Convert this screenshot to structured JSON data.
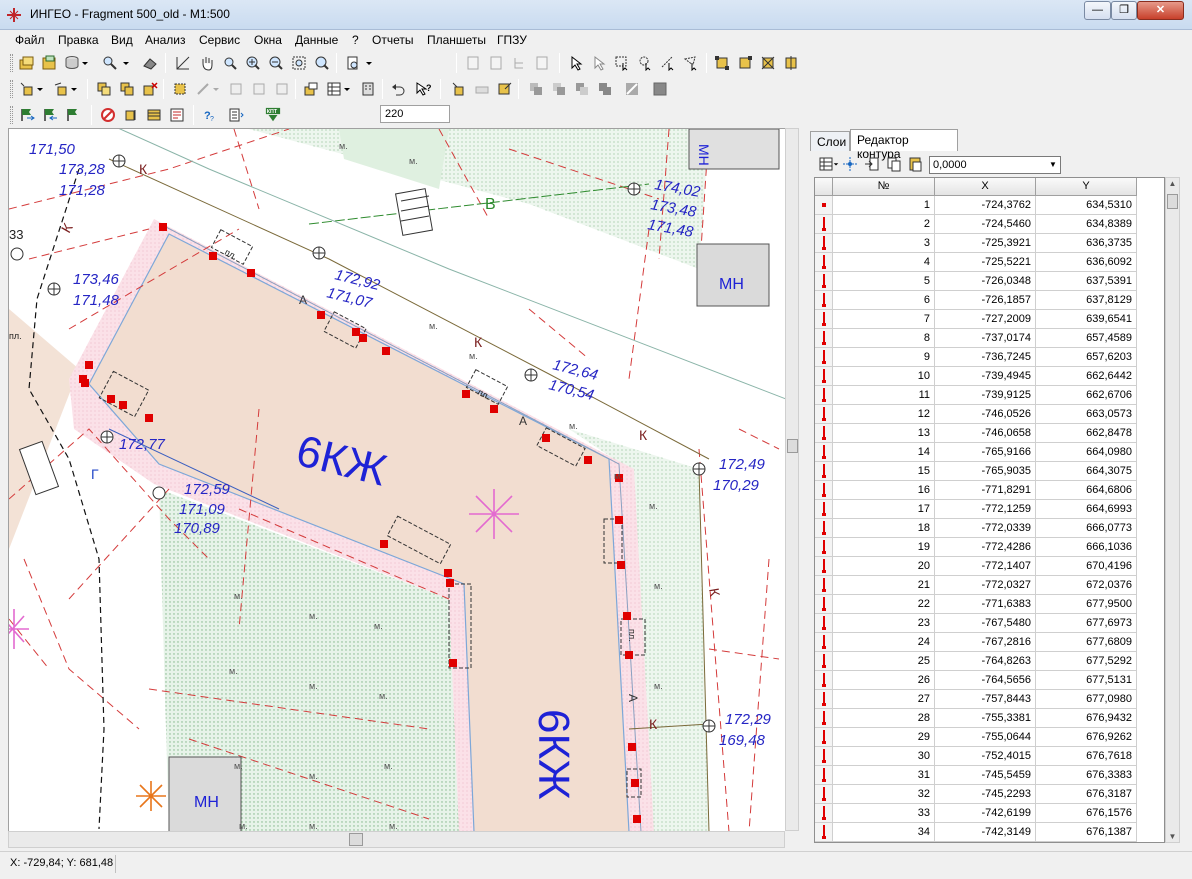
{
  "window": {
    "title": "ИНГЕО - Fragment 500_old - M1:500",
    "close_glyph": "✕",
    "min_glyph": "—",
    "max_glyph": "❐"
  },
  "menu": [
    "Файл",
    "Правка",
    "Вид",
    "Анализ",
    "Сервис",
    "Окна",
    "Данные",
    "?",
    "Отчеты",
    "Планшеты",
    "ГПЗУ"
  ],
  "toolbar": {
    "zoom_value": "220"
  },
  "status": {
    "coords": "X: -729,84; Y: 681,48"
  },
  "panel": {
    "tabs": [
      "Слои",
      "Редактор контура"
    ],
    "offset_value": "0,0000",
    "columns": [
      "№",
      "X",
      "Y"
    ],
    "rows": [
      {
        "n": "1",
        "x": "-724,3762",
        "y": "634,5310"
      },
      {
        "n": "2",
        "x": "-724,5460",
        "y": "634,8389"
      },
      {
        "n": "3",
        "x": "-725,3921",
        "y": "636,3735"
      },
      {
        "n": "4",
        "x": "-725,5221",
        "y": "636,6092"
      },
      {
        "n": "5",
        "x": "-726,0348",
        "y": "637,5391"
      },
      {
        "n": "6",
        "x": "-726,1857",
        "y": "637,8129"
      },
      {
        "n": "7",
        "x": "-727,2009",
        "y": "639,6541"
      },
      {
        "n": "8",
        "x": "-737,0174",
        "y": "657,4589"
      },
      {
        "n": "9",
        "x": "-736,7245",
        "y": "657,6203"
      },
      {
        "n": "10",
        "x": "-739,4945",
        "y": "662,6442"
      },
      {
        "n": "11",
        "x": "-739,9125",
        "y": "662,6706"
      },
      {
        "n": "12",
        "x": "-746,0526",
        "y": "663,0573"
      },
      {
        "n": "13",
        "x": "-746,0658",
        "y": "662,8478"
      },
      {
        "n": "14",
        "x": "-765,9166",
        "y": "664,0980"
      },
      {
        "n": "15",
        "x": "-765,9035",
        "y": "664,3075"
      },
      {
        "n": "16",
        "x": "-771,8291",
        "y": "664,6806"
      },
      {
        "n": "17",
        "x": "-772,1259",
        "y": "664,6993"
      },
      {
        "n": "18",
        "x": "-772,0339",
        "y": "666,0773"
      },
      {
        "n": "19",
        "x": "-772,4286",
        "y": "666,1036"
      },
      {
        "n": "20",
        "x": "-772,1407",
        "y": "670,4196"
      },
      {
        "n": "21",
        "x": "-772,0327",
        "y": "672,0376"
      },
      {
        "n": "22",
        "x": "-771,6383",
        "y": "677,9500"
      },
      {
        "n": "23",
        "x": "-767,5480",
        "y": "677,6973"
      },
      {
        "n": "24",
        "x": "-767,2816",
        "y": "677,6809"
      },
      {
        "n": "25",
        "x": "-764,8263",
        "y": "677,5292"
      },
      {
        "n": "26",
        "x": "-764,5656",
        "y": "677,5131"
      },
      {
        "n": "27",
        "x": "-757,8443",
        "y": "677,0980"
      },
      {
        "n": "28",
        "x": "-755,3381",
        "y": "676,9432"
      },
      {
        "n": "29",
        "x": "-755,0644",
        "y": "676,9262"
      },
      {
        "n": "30",
        "x": "-752,4015",
        "y": "676,7618"
      },
      {
        "n": "31",
        "x": "-745,5459",
        "y": "676,3383"
      },
      {
        "n": "32",
        "x": "-745,2293",
        "y": "676,3187"
      },
      {
        "n": "33",
        "x": "-742,6199",
        "y": "676,1576"
      },
      {
        "n": "34",
        "x": "-742,3149",
        "y": "676,1387"
      }
    ]
  },
  "map": {
    "zone_label": "6КЖ",
    "mn_label": "МН",
    "pp_label": "пл.",
    "a_label": "А",
    "k_label": "К",
    "v_label": "В",
    "g_label": "Г",
    "num_33": "33",
    "elev": {
      "e1a": "171,50",
      "e2a": "173,28",
      "e2b": "171,28",
      "e3a": "173,46",
      "e3b": "171,48",
      "e4a": "172,92",
      "e4b": "171,07",
      "e5a": "174,02",
      "e5b": "173,48",
      "e5c": "171,48",
      "e6a": "172,64",
      "e6b": "170,54",
      "e7a": "172,77",
      "e8a": "172,59",
      "e8b": "171,09",
      "e8c": "170,89",
      "e9a": "172,49",
      "e9b": "170,29",
      "e10a": "172,29",
      "e10b": "169,48"
    }
  }
}
